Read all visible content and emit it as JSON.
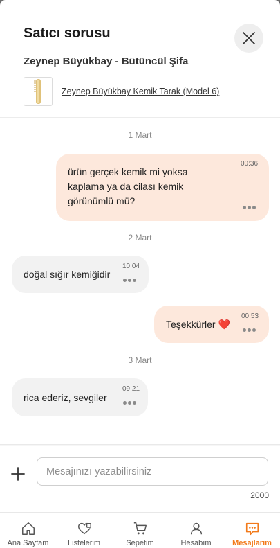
{
  "header": {
    "title": "Satıcı sorusu",
    "seller": "Zeynep Büyükbay - Bütüncül Şifa",
    "product_name": "Zeynep Büyükbay Kemik Tarak (Model 6)"
  },
  "messages": [
    {
      "date": "1 Mart",
      "direction": "outgoing",
      "text": "ürün gerçek kemik mi yoksa kaplama ya da cilası kemik görünümlü mü?",
      "time": "00:36"
    },
    {
      "date": "2 Mart",
      "direction": "incoming",
      "text": "doğal sığır kemiğidir",
      "time": "10:04"
    },
    {
      "direction": "outgoing",
      "text": "Teşekkürler ❤️",
      "time": "00:53"
    },
    {
      "date": "3 Mart",
      "direction": "incoming",
      "text": "rica ederiz, sevgiler",
      "time": "09:21"
    }
  ],
  "composer": {
    "placeholder": "Mesajınızı yazabilirsiniz",
    "char_limit": "2000"
  },
  "nav": {
    "items": [
      {
        "label": "Ana Sayfam",
        "icon": "home-icon",
        "active": false
      },
      {
        "label": "Listelerim",
        "icon": "heart-list-icon",
        "active": false
      },
      {
        "label": "Sepetim",
        "icon": "cart-icon",
        "active": false
      },
      {
        "label": "Hesabım",
        "icon": "user-icon",
        "active": false
      },
      {
        "label": "Mesajlarım",
        "icon": "message-icon",
        "active": true
      }
    ]
  },
  "colors": {
    "accent": "#f27a1a",
    "outgoing_bubble": "#fde8dc",
    "incoming_bubble": "#f2f2f2"
  }
}
